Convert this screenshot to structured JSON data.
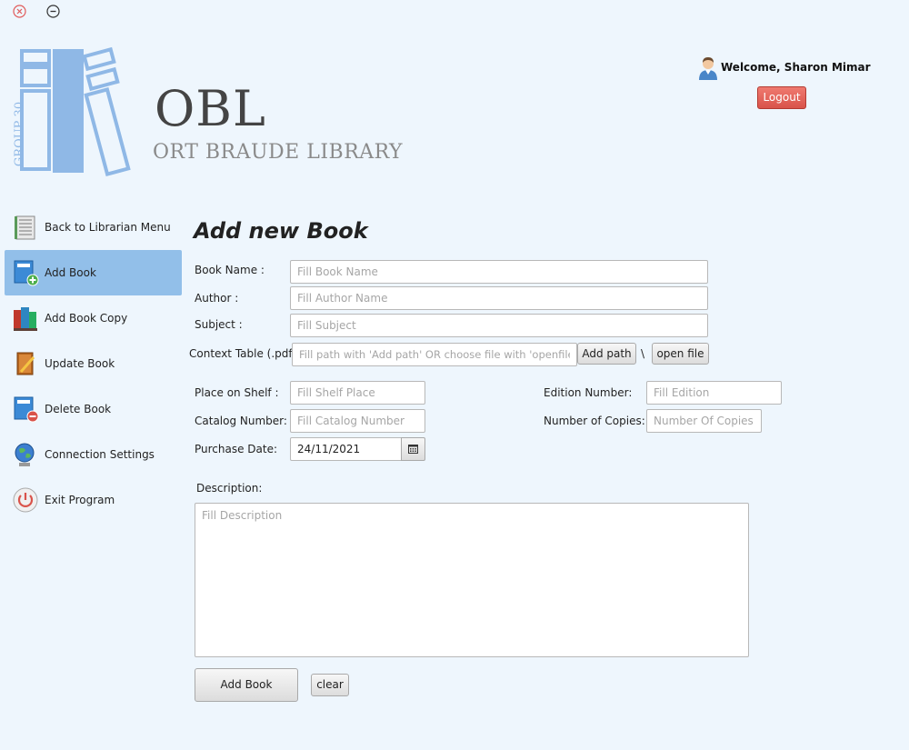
{
  "window": {
    "close_icon": "close-icon",
    "minimize_icon": "minimize-icon"
  },
  "logo": {
    "title": "OBL",
    "subtitle": "ORT BRAUDE LIBRARY",
    "group": "GROUP 30"
  },
  "user": {
    "welcome": "Welcome, Sharon Mimar",
    "logout_label": "Logout"
  },
  "sidebar": {
    "items": [
      {
        "label": "Back to Librarian Menu",
        "icon": "book-stack-icon"
      },
      {
        "label": "Add Book",
        "icon": "add-book-icon",
        "active": true
      },
      {
        "label": "Add Book Copy",
        "icon": "books-icon"
      },
      {
        "label": "Update Book",
        "icon": "edit-book-icon"
      },
      {
        "label": "Delete Book",
        "icon": "delete-book-icon"
      },
      {
        "label": "Connection Settings",
        "icon": "globe-icon"
      },
      {
        "label": "Exit Program",
        "icon": "power-icon"
      }
    ]
  },
  "form": {
    "title": "Add new Book",
    "book_name": {
      "label": "Book Name :",
      "placeholder": "Fill Book Name",
      "value": ""
    },
    "author": {
      "label": "Author :",
      "placeholder": "Fill Author Name",
      "value": ""
    },
    "subject": {
      "label": "Subject :",
      "placeholder": "Fill Subject",
      "value": ""
    },
    "context_table": {
      "label": "Context Table (.pdf):",
      "placeholder": "Fill path with 'Add path' OR choose file with 'openfile'",
      "value": "",
      "add_path_label": "Add path",
      "separator": "\\",
      "open_file_label": "open file"
    },
    "place_on_shelf": {
      "label": "Place on Shelf :",
      "placeholder": "Fill Shelf Place",
      "value": ""
    },
    "catalog_number": {
      "label": "Catalog Number:",
      "placeholder": "Fill Catalog Number",
      "value": ""
    },
    "purchase_date": {
      "label": "Purchase Date:",
      "value": "24/11/2021"
    },
    "edition_number": {
      "label": "Edition Number:",
      "placeholder": "Fill Edition",
      "value": ""
    },
    "number_of_copies": {
      "label": "Number of Copies:",
      "placeholder": "Number Of Copies",
      "value": ""
    },
    "description": {
      "label": "Description:",
      "placeholder": "Fill Description",
      "value": ""
    },
    "add_book_label": "Add Book",
    "clear_label": "clear"
  },
  "colors": {
    "background": "#eef6fd",
    "accent": "#92bfe9",
    "logout": "#d9534a",
    "logo_blue": "#8fb8e6"
  }
}
